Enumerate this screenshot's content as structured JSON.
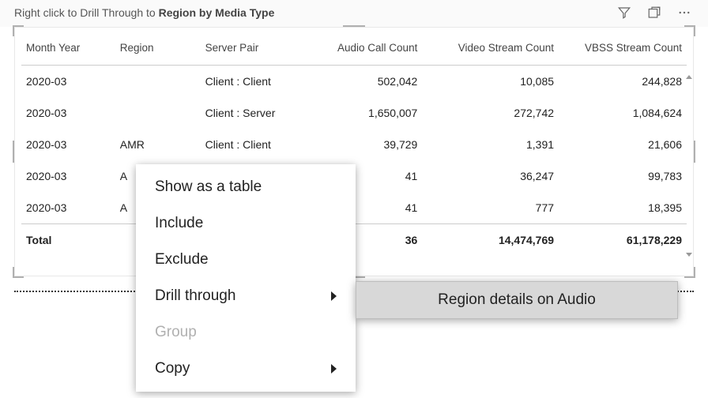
{
  "header": {
    "hint_prefix": "Right click to Drill Through to ",
    "hint_bold": "Region by Media Type"
  },
  "columns": {
    "month_year": "Month Year",
    "region": "Region",
    "server_pair": "Server Pair",
    "audio_count": "Audio Call Count",
    "video_count": "Video Stream Count",
    "vbss_count": "VBSS Stream Count"
  },
  "rows": [
    {
      "month_year": "2020-03",
      "region": "",
      "server_pair": "Client : Client",
      "audio": "502,042",
      "video": "10,085",
      "vbss": "244,828"
    },
    {
      "month_year": "2020-03",
      "region": "",
      "server_pair": "Client : Server",
      "audio": "1,650,007",
      "video": "272,742",
      "vbss": "1,084,624"
    },
    {
      "month_year": "2020-03",
      "region": "AMR",
      "server_pair": "Client : Client",
      "audio": "39,729",
      "video": "1,391",
      "vbss": "21,606"
    },
    {
      "month_year": "2020-03",
      "region": "A",
      "server_pair": "",
      "audio": "41",
      "video": "36,247",
      "vbss": "99,783"
    },
    {
      "month_year": "2020-03",
      "region": "A",
      "server_pair": "",
      "audio": "41",
      "video": "777",
      "vbss": "18,395"
    }
  ],
  "total": {
    "label": "Total",
    "audio": "36",
    "video": "14,474,769",
    "vbss": "61,178,229"
  },
  "context_menu": {
    "show_table": "Show as a table",
    "include": "Include",
    "exclude": "Exclude",
    "drill_through": "Drill through",
    "group": "Group",
    "copy": "Copy"
  },
  "submenu": {
    "region_details_audio": "Region details on Audio"
  }
}
